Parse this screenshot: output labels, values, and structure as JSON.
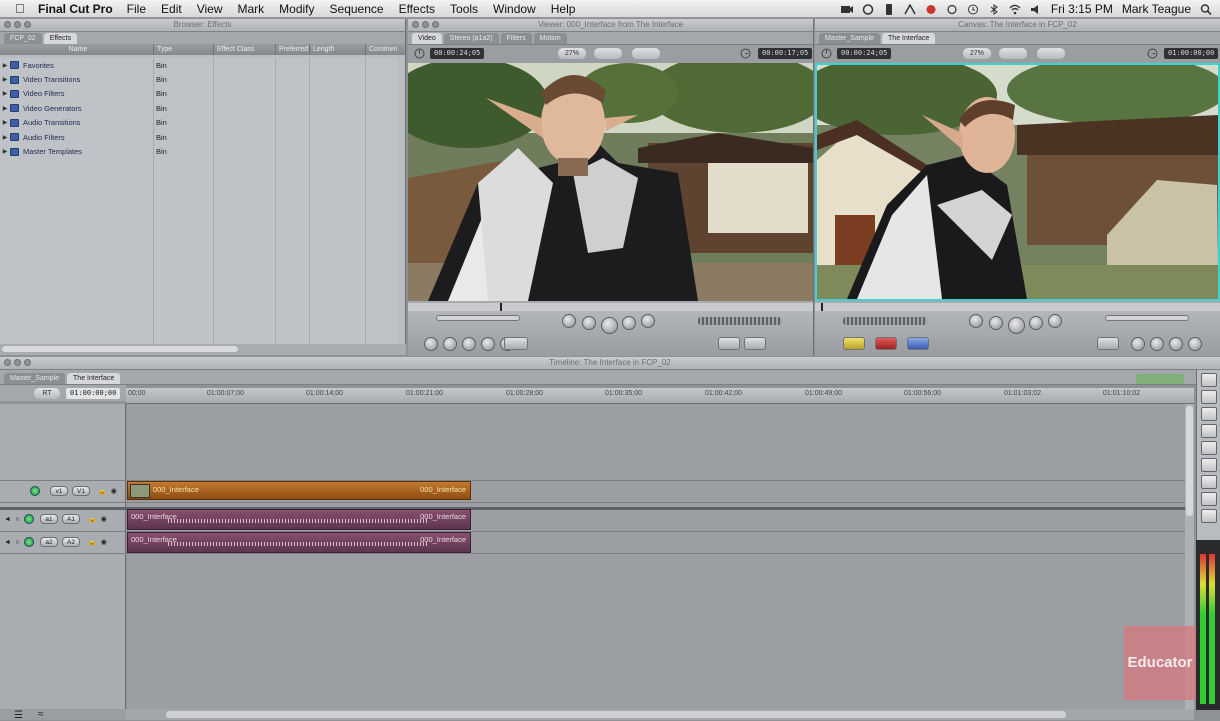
{
  "menubar": {
    "app": "Final Cut Pro",
    "items": [
      "File",
      "Edit",
      "View",
      "Mark",
      "Modify",
      "Sequence",
      "Effects",
      "Tools",
      "Window",
      "Help"
    ],
    "clock": "Fri 3:15 PM",
    "user": "Mark Teague"
  },
  "browser": {
    "title": "Browser: Effects",
    "tabs": [
      "FCP_02",
      "Effects"
    ],
    "columns": [
      "Name",
      "Type",
      "Effect Class",
      "Preferred",
      "Length",
      "Commen"
    ],
    "rows": [
      {
        "name": "Favorites",
        "type": "Bin"
      },
      {
        "name": "Video Transitions",
        "type": "Bin"
      },
      {
        "name": "Video Filters",
        "type": "Bin"
      },
      {
        "name": "Video Generators",
        "type": "Bin"
      },
      {
        "name": "Audio Transitions",
        "type": "Bin"
      },
      {
        "name": "Audio Filters",
        "type": "Bin"
      },
      {
        "name": "Master Templates",
        "type": "Bin"
      }
    ]
  },
  "viewer": {
    "title": "Viewer: 000_Interface from The Interface",
    "tabs": [
      "Video",
      "Stereo (a1a2)",
      "Filters",
      "Motion"
    ],
    "duration": "00:00:24;05",
    "zoom": "27%",
    "current": "00:00:17;05"
  },
  "canvas": {
    "title": "Canvas: The Interface in FCP_02",
    "tabs": [
      "Master_Sample",
      "The Interface"
    ],
    "duration": "00:00:24;05",
    "zoom": "27%",
    "current": "01:00:00;00"
  },
  "timeline": {
    "title": "Timeline: The Interface in FCP_02",
    "tabs": [
      "Master_Sample",
      "The Interface"
    ],
    "rt": "RT",
    "timecode": "01:00:00;00",
    "ruler": [
      "00;00",
      "01:00:07;00",
      "01:00:14;00",
      "01:00:21;00",
      "01:00:28;00",
      "01:00:35;00",
      "01:00:42;00",
      "01:00:49;00",
      "01:00:56;00",
      "01:01:03;02",
      "01:01:10;02"
    ],
    "tracks": {
      "v1_src": "v1",
      "v1_dst": "V1",
      "a1_src": "a1",
      "a1_dst": "A1",
      "a2_src": "a2",
      "a2_dst": "A2"
    },
    "clip_name": "000_Interface"
  },
  "watermark": "Educator",
  "colors": {
    "video_clip": "#a8621f",
    "audio_clip": "#734361",
    "accent_canvas": "#3fd0d0"
  }
}
